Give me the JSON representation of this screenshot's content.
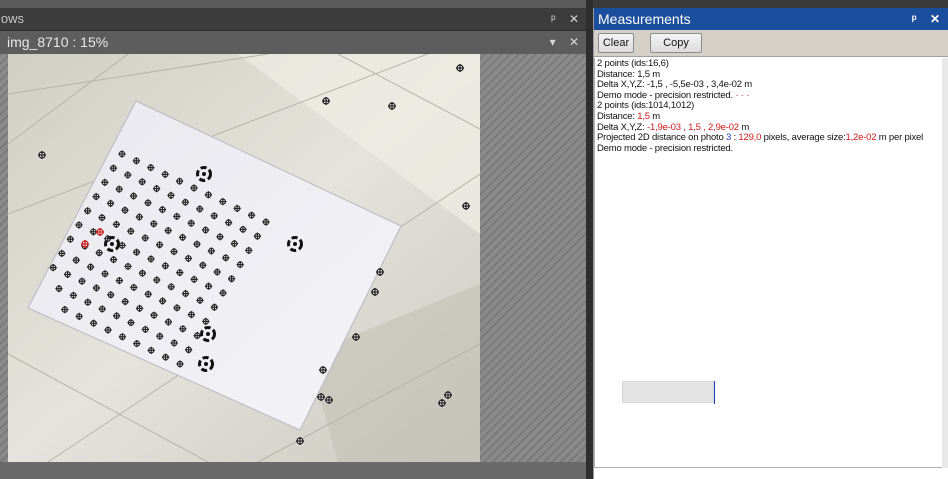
{
  "left_panel": {
    "window_title": "lows",
    "document_title": "img_8710 : 15%",
    "pin_glyph": "ᵖ",
    "close_glyph": "✕",
    "dropdown_glyph": "▾"
  },
  "right_panel": {
    "title": "Measurements",
    "pin_glyph": "ᵖ",
    "close_glyph": "✕",
    "toolbar": {
      "clear_label": "Clear",
      "copy_label": "Copy"
    },
    "lines": [
      [
        {
          "t": "2 points (ids:16,6)"
        }
      ],
      [
        {
          "t": "Distance: 1,5 m"
        }
      ],
      [
        {
          "t": "Delta X,Y,Z: -1,5 , -5,5e-03 , 3,4e-02 m"
        }
      ],
      [
        {
          "t": "Demo mode - precision restricted."
        },
        {
          "t": " · · ·",
          "c": "red"
        }
      ],
      [
        {
          "t": "2 points (ids:1014,1012)"
        }
      ],
      [
        {
          "t": "Distance: "
        },
        {
          "t": "1,5",
          "c": "red"
        },
        {
          "t": " m"
        }
      ],
      [
        {
          "t": "Delta X,Y,Z: "
        },
        {
          "t": "-1,9e-03 , 1,5 , 2,9e-02",
          "c": "red"
        },
        {
          "t": " m"
        }
      ],
      [
        {
          "t": "Projected 2D distance on photo "
        },
        {
          "t": "3",
          "c": "blue"
        },
        {
          "t": " : "
        },
        {
          "t": "129,0",
          "c": "red"
        },
        {
          "t": " pixels, average size:"
        },
        {
          "t": "1,2e-02",
          "c": "red"
        },
        {
          "t": " m per pixel"
        }
      ],
      [
        {
          "t": "Demo mode - precision restricted."
        }
      ]
    ]
  },
  "colors": {
    "header_blue": "#1c4e9e",
    "highlight_red": "#d11a1a",
    "link_blue": "#2233cc"
  }
}
